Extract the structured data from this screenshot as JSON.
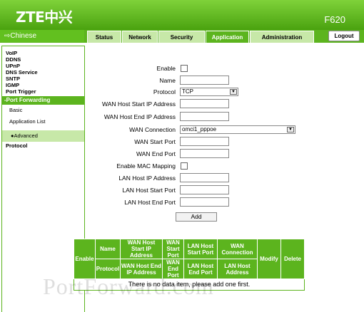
{
  "header": {
    "brand": "ZTE中兴",
    "model": "F620"
  },
  "nav": {
    "language": "Chinese",
    "tabs": [
      {
        "label": "Status"
      },
      {
        "label": "Network"
      },
      {
        "label": "Security"
      },
      {
        "label": "Application"
      },
      {
        "label": "Administration"
      }
    ],
    "active_tab": "Application",
    "logout": "Logout"
  },
  "sidebar": {
    "items": [
      "VoIP",
      "DDNS",
      "UPnP",
      "DNS Service",
      "SNTP",
      "IGMP",
      "Port Trigger"
    ],
    "port_forwarding": "-Port Forwarding",
    "sub_items": [
      "Basic",
      "Application List"
    ],
    "advanced": "Advanced",
    "protocol": "Protocol"
  },
  "form": {
    "enable_label": "Enable",
    "name_label": "Name",
    "protocol_label": "Protocol",
    "protocol_value": "TCP",
    "wan_host_start_label": "WAN Host Start IP Address",
    "wan_host_end_label": "WAN Host End IP Address",
    "wan_connection_label": "WAN Connection",
    "wan_connection_value": "omci1_pppoe",
    "wan_start_port_label": "WAN Start Port",
    "wan_end_port_label": "WAN End Port",
    "mac_mapping_label": "Enable MAC Mapping",
    "lan_host_ip_label": "LAN Host IP Address",
    "lan_host_start_port_label": "LAN Host Start Port",
    "lan_host_end_port_label": "LAN Host End Port",
    "add_button": "Add"
  },
  "table": {
    "enable": "Enable",
    "name": "Name",
    "wan_host_start": "WAN Host Start IP Address",
    "wan_start_port": "WAN Start Port",
    "lan_host_start_port": "LAN Host Start Port",
    "wan_connection": "WAN Connection",
    "modify": "Modify",
    "delete": "Delete",
    "protocol": "Protocol",
    "wan_host_end": "WAN Host End IP Address",
    "wan_end_port": "WAN End Port",
    "lan_host_end_port": "LAN Host End Port",
    "lan_host_address": "LAN Host Address",
    "empty_message": "There is no data item, please add one first."
  },
  "watermark": "PortForward.com"
}
